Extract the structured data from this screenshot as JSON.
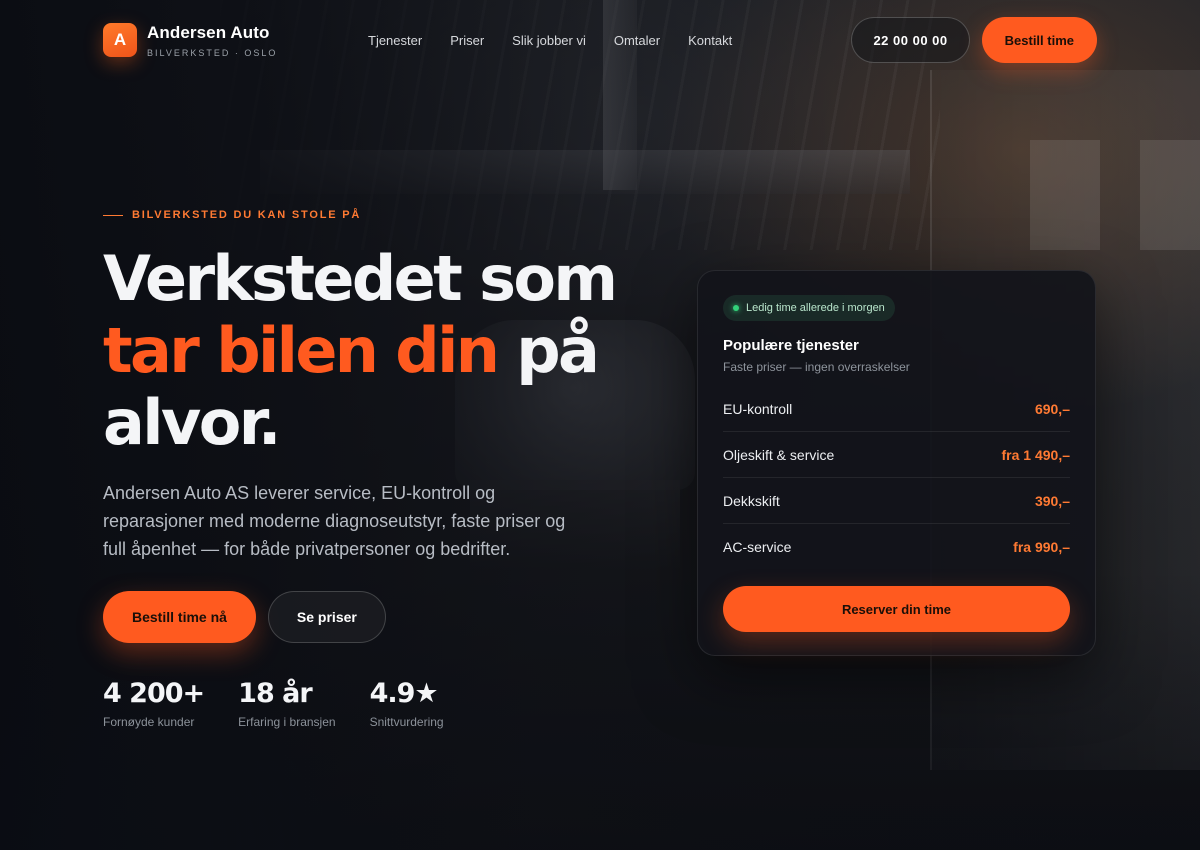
{
  "brand": {
    "logo_letter": "A",
    "name": "Andersen Auto",
    "tagline": "BILVERKSTED · OSLO"
  },
  "nav": {
    "items": [
      {
        "label": "Tjenester"
      },
      {
        "label": "Priser"
      },
      {
        "label": "Slik jobber vi"
      },
      {
        "label": "Omtaler"
      },
      {
        "label": "Kontakt"
      }
    ]
  },
  "header": {
    "phone_label": "22 00 00 00",
    "cta_label": "Bestill time"
  },
  "hero": {
    "eyebrow": "BILVERKSTED DU KAN STOLE PÅ",
    "headline_part1": "Verkstedet som",
    "headline_accent": "tar bilen din",
    "headline_part2": "på",
    "headline_part3": "alvor.",
    "lead": "Andersen Auto AS leverer service, EU-kontroll og reparasjoner med moderne diagnoseutstyr, faste priser og full åpenhet — for både privatpersoner og bedrifter.",
    "primary_button": "Bestill time nå",
    "secondary_button": "Se priser"
  },
  "stats": [
    {
      "value": "4 200+",
      "label": "Fornøyde kunder"
    },
    {
      "value": "18 år",
      "label": "Erfaring i bransjen"
    },
    {
      "value": "4.9★",
      "label": "Snittvurdering"
    }
  ],
  "card": {
    "availability": "Ledig time allerede i morgen",
    "title": "Populære tjenester",
    "subtitle": "Faste priser — ingen overraskelser",
    "services": [
      {
        "name": "EU-kontroll",
        "price": "690,–"
      },
      {
        "name": "Oljeskift & service",
        "price": "fra 1 490,–"
      },
      {
        "name": "Dekkskift",
        "price": "390,–"
      },
      {
        "name": "AC-service",
        "price": "fra 990,–"
      }
    ],
    "reserve_button": "Reserver din time"
  },
  "colors": {
    "accent": "#ff5a1f",
    "accent_text": "#ff7a33",
    "status_green": "#33d17a"
  }
}
